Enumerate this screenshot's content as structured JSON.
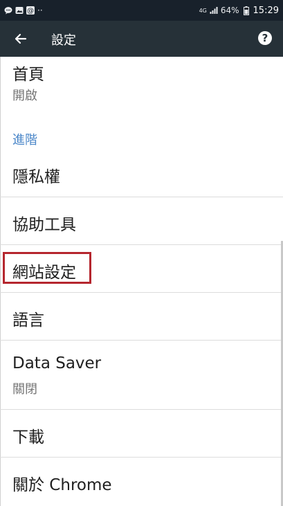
{
  "status_bar": {
    "left_icons": [
      "chat-bubble-icon",
      "image-icon",
      "at-sign-icon",
      "more-dots-icon"
    ],
    "more_dots": "··",
    "network": "4G",
    "battery_percent": "64%",
    "time": "15:29"
  },
  "toolbar": {
    "title": "設定"
  },
  "settings": {
    "homepage": {
      "title": "首頁",
      "subtitle": "開啟"
    },
    "advanced_header": "進階",
    "privacy": {
      "title": "隱私權"
    },
    "accessibility": {
      "title": "協助工具"
    },
    "site_settings": {
      "title": "網站設定"
    },
    "languages": {
      "title": "語言"
    },
    "data_saver": {
      "title": "Data Saver",
      "subtitle": "關閉"
    },
    "downloads": {
      "title": "下載"
    },
    "about": {
      "title": "關於 Chrome"
    }
  },
  "colors": {
    "status_bar_bg": "#18212b",
    "toolbar_bg": "#263138",
    "section_header": "#4a86c8",
    "highlight_border": "#b5262e"
  }
}
